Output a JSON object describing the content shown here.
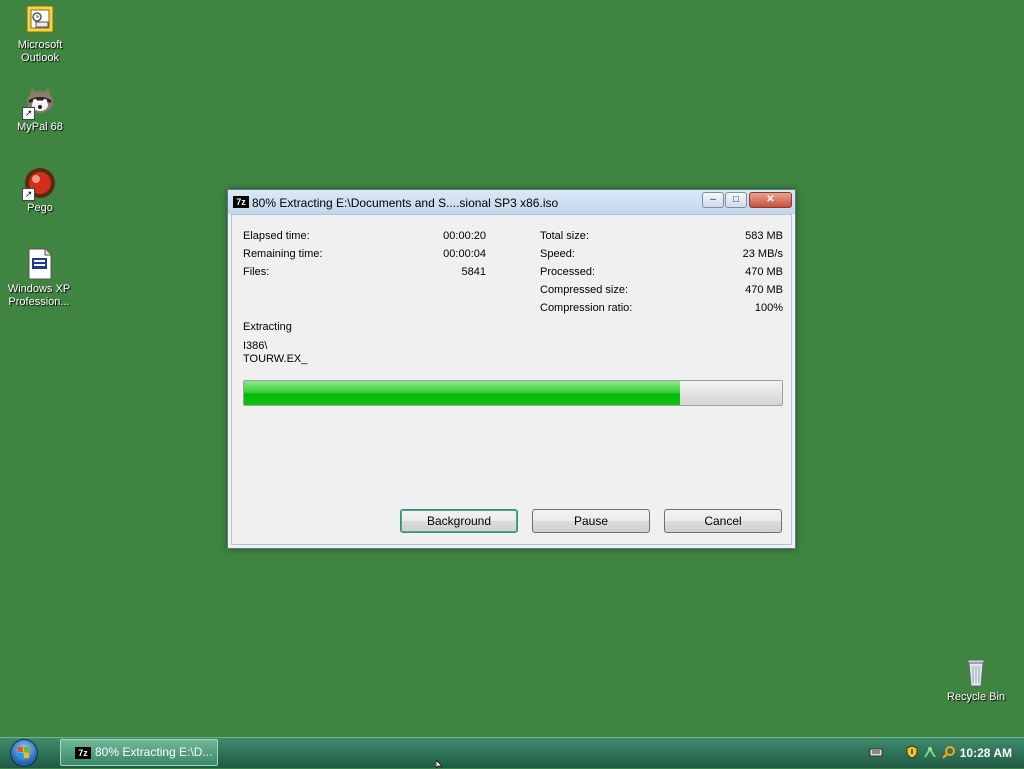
{
  "desktop": {
    "icons": [
      {
        "label_1": "Microsoft",
        "label_2": "Outlook",
        "icon": "outlook-icon"
      },
      {
        "label_1": "MyPal 68",
        "label_2": "",
        "icon": "mypal-raccoon-icon"
      },
      {
        "label_1": "Pego",
        "label_2": "",
        "icon": "pego-red-ball-icon"
      },
      {
        "label_1": "Windows XP",
        "label_2": "Profession...",
        "icon": "iso-file-icon"
      },
      {
        "label_1": "Recycle Bin",
        "label_2": "",
        "icon": "recycle-bin-icon"
      }
    ]
  },
  "window": {
    "app_badge": "7z",
    "title": "80% Extracting E:\\Documents and S....sional SP3 x86.iso",
    "min_glyph": "–",
    "max_glyph": "□",
    "close_glyph": "✕"
  },
  "stats_left": [
    {
      "label": "Elapsed time:",
      "value": "00:00:20"
    },
    {
      "label": "Remaining time:",
      "value": "00:00:04"
    },
    {
      "label": "Files:",
      "value": "5841"
    }
  ],
  "stats_right": [
    {
      "label": "Total size:",
      "value": "583 MB"
    },
    {
      "label": "Speed:",
      "value": "23 MB/s"
    },
    {
      "label": "Processed:",
      "value": "470 MB"
    },
    {
      "label": "Compressed size:",
      "value": "470 MB"
    },
    {
      "label": "Compression ratio:",
      "value": "100%"
    }
  ],
  "extracting": {
    "label": "Extracting",
    "folder": "I386\\",
    "file": "TOURW.EX_"
  },
  "progress": {
    "fraction": 0.81
  },
  "buttons": {
    "background": "Background",
    "pause": "Pause",
    "cancel": "Cancel"
  },
  "taskbar": {
    "task_badge": "7z",
    "task_label": "80% Extracting E:\\D...",
    "clock": "10:28 AM"
  },
  "colors": {
    "desktop": "#3f8441",
    "progress_green": "#0ec20e"
  }
}
